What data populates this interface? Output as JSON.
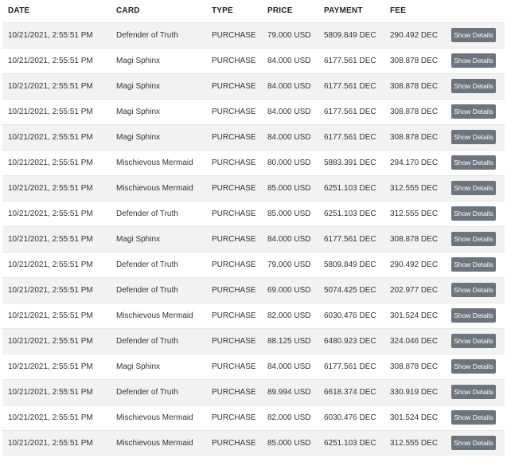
{
  "headers": {
    "date": "DATE",
    "card": "CARD",
    "type": "TYPE",
    "price": "PRICE",
    "payment": "PAYMENT",
    "fee": "FEE"
  },
  "button_label": "Show Details",
  "rows": [
    {
      "date": "10/21/2021, 2:55:51 PM",
      "card": "Defender of Truth",
      "type": "PURCHASE",
      "price": "79.000 USD",
      "payment": "5809.849 DEC",
      "fee": "290.492 DEC"
    },
    {
      "date": "10/21/2021, 2:55:51 PM",
      "card": "Magi Sphinx",
      "type": "PURCHASE",
      "price": "84.000 USD",
      "payment": "6177.561 DEC",
      "fee": "308.878 DEC"
    },
    {
      "date": "10/21/2021, 2:55:51 PM",
      "card": "Magi Sphinx",
      "type": "PURCHASE",
      "price": "84.000 USD",
      "payment": "6177.561 DEC",
      "fee": "308.878 DEC"
    },
    {
      "date": "10/21/2021, 2:55:51 PM",
      "card": "Magi Sphinx",
      "type": "PURCHASE",
      "price": "84.000 USD",
      "payment": "6177.561 DEC",
      "fee": "308.878 DEC"
    },
    {
      "date": "10/21/2021, 2:55:51 PM",
      "card": "Magi Sphinx",
      "type": "PURCHASE",
      "price": "84.000 USD",
      "payment": "6177.561 DEC",
      "fee": "308.878 DEC"
    },
    {
      "date": "10/21/2021, 2:55:51 PM",
      "card": "Mischievous Mermaid",
      "type": "PURCHASE",
      "price": "80.000 USD",
      "payment": "5883.391 DEC",
      "fee": "294.170 DEC"
    },
    {
      "date": "10/21/2021, 2:55:51 PM",
      "card": "Mischievous Mermaid",
      "type": "PURCHASE",
      "price": "85.000 USD",
      "payment": "6251.103 DEC",
      "fee": "312.555 DEC"
    },
    {
      "date": "10/21/2021, 2:55:51 PM",
      "card": "Defender of Truth",
      "type": "PURCHASE",
      "price": "85.000 USD",
      "payment": "6251.103 DEC",
      "fee": "312.555 DEC"
    },
    {
      "date": "10/21/2021, 2:55:51 PM",
      "card": "Magi Sphinx",
      "type": "PURCHASE",
      "price": "84.000 USD",
      "payment": "6177.561 DEC",
      "fee": "308.878 DEC"
    },
    {
      "date": "10/21/2021, 2:55:51 PM",
      "card": "Defender of Truth",
      "type": "PURCHASE",
      "price": "79.000 USD",
      "payment": "5809.849 DEC",
      "fee": "290.492 DEC"
    },
    {
      "date": "10/21/2021, 2:55:51 PM",
      "card": "Defender of Truth",
      "type": "PURCHASE",
      "price": "69.000 USD",
      "payment": "5074.425 DEC",
      "fee": "202.977 DEC"
    },
    {
      "date": "10/21/2021, 2:55:51 PM",
      "card": "Mischievous Mermaid",
      "type": "PURCHASE",
      "price": "82.000 USD",
      "payment": "6030.476 DEC",
      "fee": "301.524 DEC"
    },
    {
      "date": "10/21/2021, 2:55:51 PM",
      "card": "Defender of Truth",
      "type": "PURCHASE",
      "price": "88.125 USD",
      "payment": "6480.923 DEC",
      "fee": "324.046 DEC"
    },
    {
      "date": "10/21/2021, 2:55:51 PM",
      "card": "Magi Sphinx",
      "type": "PURCHASE",
      "price": "84.000 USD",
      "payment": "6177.561 DEC",
      "fee": "308.878 DEC"
    },
    {
      "date": "10/21/2021, 2:55:51 PM",
      "card": "Defender of Truth",
      "type": "PURCHASE",
      "price": "89.994 USD",
      "payment": "6618.374 DEC",
      "fee": "330.919 DEC"
    },
    {
      "date": "10/21/2021, 2:55:51 PM",
      "card": "Mischievous Mermaid",
      "type": "PURCHASE",
      "price": "82.000 USD",
      "payment": "6030.476 DEC",
      "fee": "301.524 DEC"
    },
    {
      "date": "10/21/2021, 2:55:51 PM",
      "card": "Mischievous Mermaid",
      "type": "PURCHASE",
      "price": "85.000 USD",
      "payment": "6251.103 DEC",
      "fee": "312.555 DEC"
    }
  ]
}
